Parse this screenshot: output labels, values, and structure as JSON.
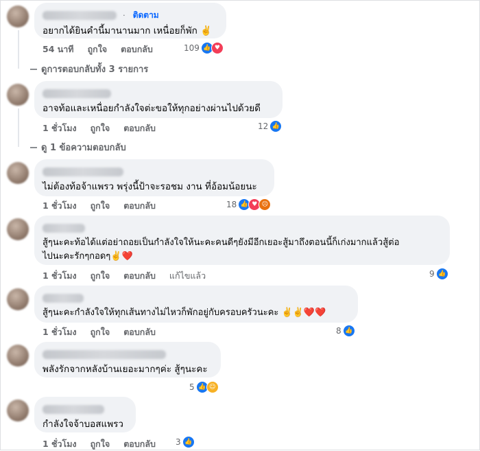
{
  "comments": [
    {
      "follow": "ติดตาม",
      "text": "อยากได้ยินคำนี้มานานมาก เหนื่อยก็พัก ✌️",
      "time": "54 นาที",
      "like": "ถูกใจ",
      "reply": "ตอบกลับ",
      "count": "109",
      "reactions": [
        "like-icon",
        "love-icon"
      ]
    },
    {
      "text": "อาจท้อและเหนื่อยกำลังใจต่ะขอให้ทุกอย่างผ่านไปด้วยดี",
      "time": "1 ชั่วโมง",
      "like": "ถูกใจ",
      "reply": "ตอบกลับ",
      "count": "12",
      "reactions": [
        "like-icon"
      ]
    },
    {
      "text": "ไม่ต้องท้อจ้าแพรว พรุ่งนี้ป้าจะรอชม งาน ที่อ้อมน้อยนะ",
      "time": "1 ชั่วโมง",
      "like": "ถูกใจ",
      "reply": "ตอบกลับ",
      "count": "18",
      "reactions": [
        "like-icon",
        "love-icon",
        "angry-icon"
      ]
    },
    {
      "text_line1": "สู้ๆนะคะท้อได้แต่อย่าถอยเป็นกำลังใจให้นะคะคนดีๆยังมีอีกเยอะสู้มาถึงตอนนี้ก็เก่งมากแล้วสู้ต่อ",
      "text_line2": "ไปนะคะรักๆกอดๆ✌️❤️",
      "time": "1 ชั่วโมง",
      "like": "ถูกใจ",
      "reply": "ตอบกลับ",
      "edited": "แก้ไขแล้ว",
      "count": "9",
      "reactions": [
        "like-icon"
      ]
    },
    {
      "text": "สู้ๆนะคะกำลังใจให้ทุกเส้นทางไม่ไหวก็พักอยู่กับครอบครัวนะคะ ✌️✌️❤️❤️",
      "time": "1 ชั่วโมง",
      "like": "ถูกใจ",
      "reply": "ตอบกลับ",
      "count": "8",
      "reactions": [
        "like-icon"
      ]
    },
    {
      "text": "พลังรักจากหลังบ้านเยอะมากๆค่ะ สู้ๆนะคะ",
      "count": "5",
      "reactions": [
        "like-icon",
        "haha-icon"
      ]
    },
    {
      "text": "กำลังใจจ้าบอสแพรว",
      "time": "1 ชั่วโมง",
      "like": "ถูกใจ",
      "reply": "ตอบกลับ",
      "count": "3",
      "reactions": [
        "like-icon"
      ]
    }
  ],
  "replies_1": "ดูการตอบกลับทั้ง 3 รายการ",
  "replies_2": "ดู 1 ข้อความตอบกลับ",
  "colors": {
    "accent": "#0866ff",
    "bubble": "#f0f2f5",
    "muted": "#65676b"
  }
}
